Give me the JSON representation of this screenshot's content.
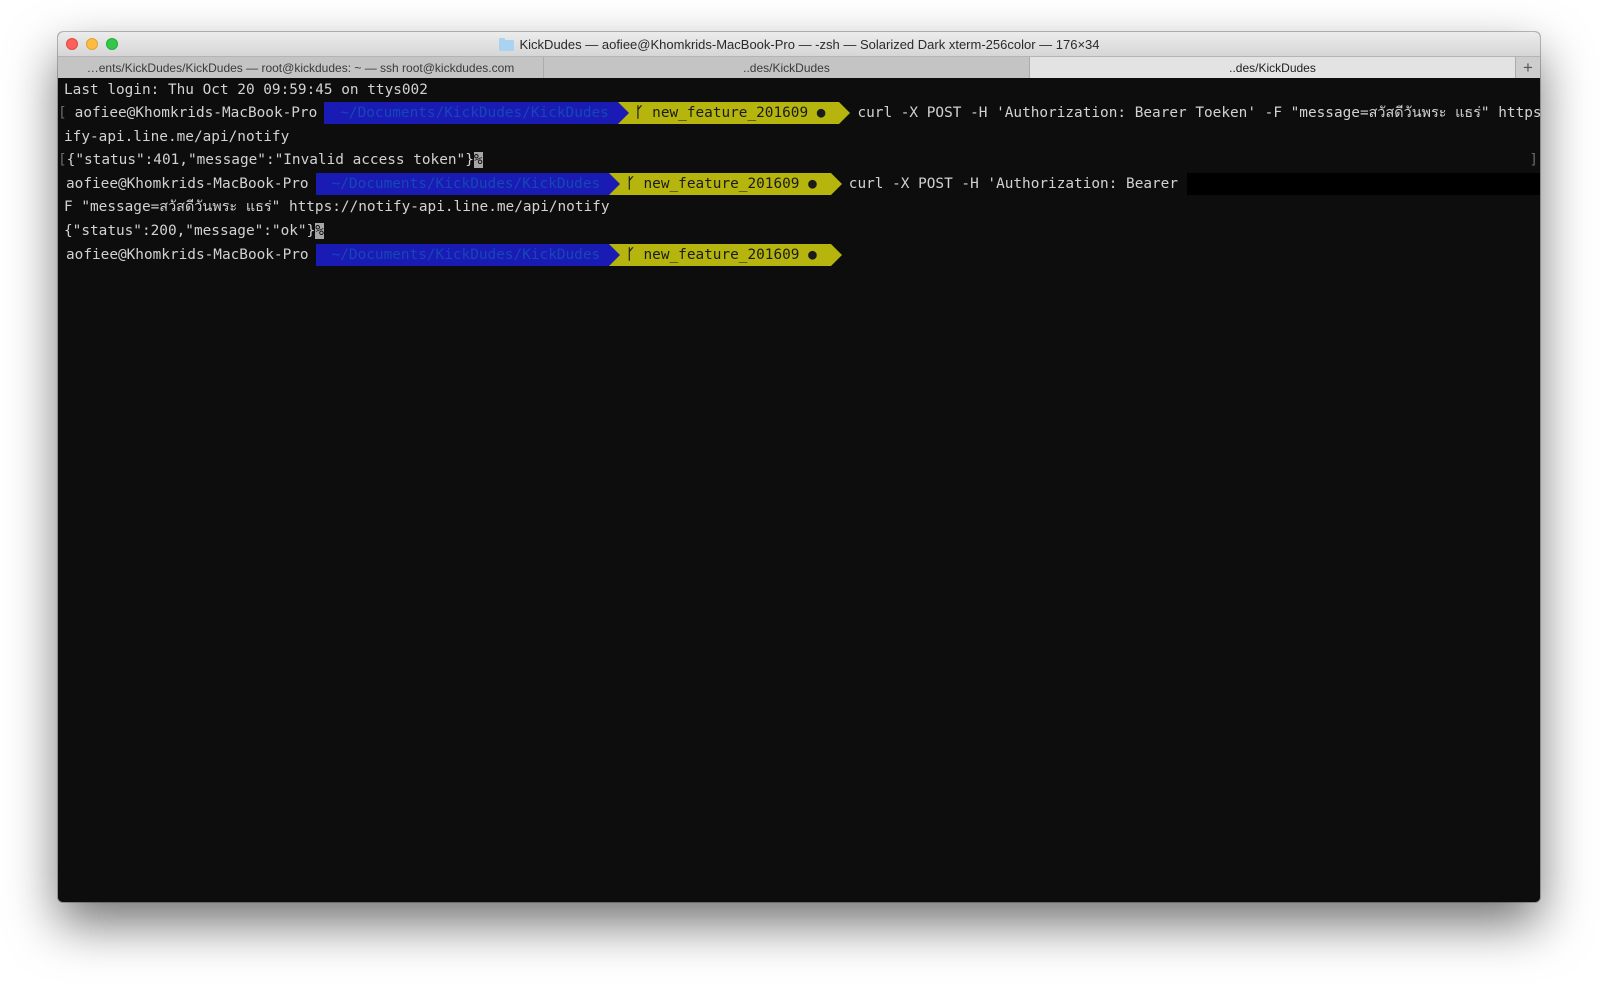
{
  "window": {
    "title": "KickDudes — aofiee@Khomkrids-MacBook-Pro — -zsh — Solarized Dark xterm-256color — 176×34"
  },
  "tabs": [
    {
      "label": "…ents/KickDudes/KickDudes — root@kickdudes: ~ — ssh root@kickdudes.com"
    },
    {
      "label": "..des/KickDudes"
    },
    {
      "label": "..des/KickDudes"
    }
  ],
  "tab_add_label": "+",
  "terminal": {
    "last_login": "Last login: Thu Oct 20 09:59:45 on ttys002",
    "prompt": {
      "user": "aofiee@Khomkrids-MacBook-Pro",
      "dir": "~/Documents/KickDudes/KickDudes",
      "branch_icon": "ᚴ",
      "branch": "new_feature_201609 ●"
    },
    "cmd1_part1": "curl -X POST -H 'Authorization: Bearer Toeken' -F \"message=สวัสดีวันพระ แธร่\" https://not",
    "cmd1_part2": "ify-api.line.me/api/notify",
    "resp1": "{\"status\":401,\"message\":\"Invalid access token\"}",
    "resp_end_mark": "%",
    "cmd2_part1": "curl -X POST -H 'Authorization: Bearer ",
    "cmd2_tail": "' -",
    "cmd2_part2": "F \"message=สวัสดีวันพระ แธร่\" https://notify-api.line.me/api/notify",
    "resp2": "{\"status\":200,\"message\":\"ok\"}",
    "bracket_left": "[",
    "bracket_right": "]"
  }
}
